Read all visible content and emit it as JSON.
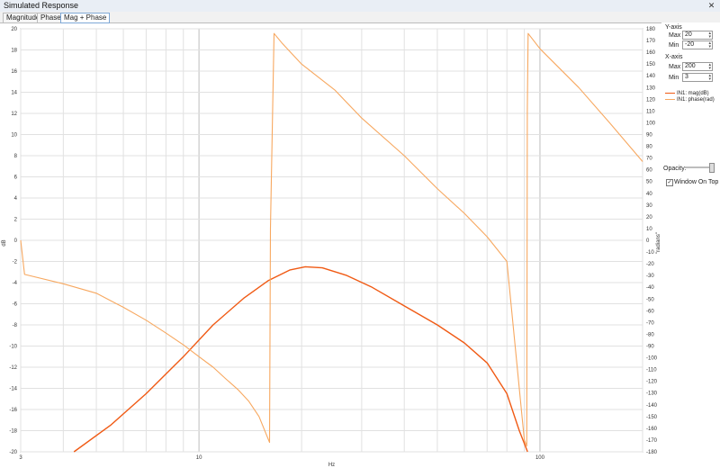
{
  "window": {
    "title": "Simulated Response",
    "close_glyph": "✕"
  },
  "tabs": [
    {
      "label": "Magnitude"
    },
    {
      "label": "Phase"
    },
    {
      "label": "Mag + Phase",
      "active": true
    }
  ],
  "controls": {
    "yaxis": {
      "title": "Y-axis",
      "max_label": "Max",
      "max_value": "20",
      "min_label": "Min",
      "min_value": "-20"
    },
    "xaxis": {
      "title": "X-axis",
      "max_label": "Max",
      "max_value": "200",
      "min_label": "Min",
      "min_value": "3"
    },
    "opacity_label": "Opacity:",
    "opacity_level": 0.95,
    "window_on_top_label": "Window On Top",
    "window_on_top_checked": true
  },
  "chart_data": {
    "type": "line",
    "xlabel": "Hz",
    "ylabel_left": "dB",
    "ylabel_right": "\"radians\"",
    "x_scale": "log",
    "xlim": [
      3,
      200
    ],
    "ylim_left": [
      -20,
      20
    ],
    "ylim_right": [
      -180,
      180
    ],
    "x_tick_labels": [
      "3",
      "10",
      "100"
    ],
    "y_left_ticks": [
      "20",
      "18",
      "16",
      "14",
      "12",
      "10",
      "8",
      "6",
      "4",
      "2",
      "0",
      "-2",
      "-4",
      "-6",
      "-8",
      "-10",
      "-12",
      "-14",
      "-16",
      "-18",
      "-20"
    ],
    "y_right_ticks": [
      "180",
      "170",
      "160",
      "150",
      "140",
      "130",
      "120",
      "110",
      "100",
      "90",
      "80",
      "70",
      "60",
      "50",
      "40",
      "30",
      "20",
      "10",
      "0",
      "-10",
      "-20",
      "-30",
      "-40",
      "-50",
      "-60",
      "-70",
      "-80",
      "-90",
      "-100",
      "-110",
      "-120",
      "-130",
      "-140",
      "-150",
      "-160",
      "-170",
      "-180"
    ],
    "grid": true,
    "legend_position": "right panel",
    "colors": {
      "mag": "#f05a14",
      "phase": "#f7a860"
    },
    "series": [
      {
        "name": "IN1: mag(dB)",
        "axis": "left",
        "color": "#f05a14",
        "x": [
          4.3,
          5.5,
          7,
          9,
          11,
          13.5,
          16,
          18.5,
          20.5,
          23,
          27,
          32,
          40,
          50,
          60,
          70,
          80,
          87,
          92
        ],
        "y": [
          -20,
          -17.5,
          -14.5,
          -11,
          -8,
          -5.5,
          -3.8,
          -2.8,
          -2.5,
          -2.6,
          -3.3,
          -4.4,
          -6.2,
          -8,
          -9.7,
          -11.6,
          -14.5,
          -18,
          -20
        ]
      },
      {
        "name": "IN1: phase(rad)",
        "axis": "right",
        "color": "#f7a860",
        "x": [
          3,
          3.08,
          4,
          5,
          6,
          7,
          8,
          9,
          10,
          11,
          12,
          13,
          14,
          15,
          16.1,
          16.2,
          16.6,
          17.5,
          20,
          25,
          30,
          40,
          50,
          60,
          70,
          80,
          90,
          91.5,
          91.8,
          92.3,
          100,
          130,
          160,
          200
        ],
        "y": [
          0,
          -29,
          -37,
          -45,
          -57,
          -68,
          -79,
          -89,
          -99,
          -108,
          -118,
          -127,
          -137,
          -150,
          -172,
          10,
          176,
          168,
          150,
          128,
          104,
          72,
          44,
          23,
          3,
          -18,
          -170,
          -175,
          110,
          176,
          163,
          130,
          100,
          67
        ]
      }
    ]
  }
}
